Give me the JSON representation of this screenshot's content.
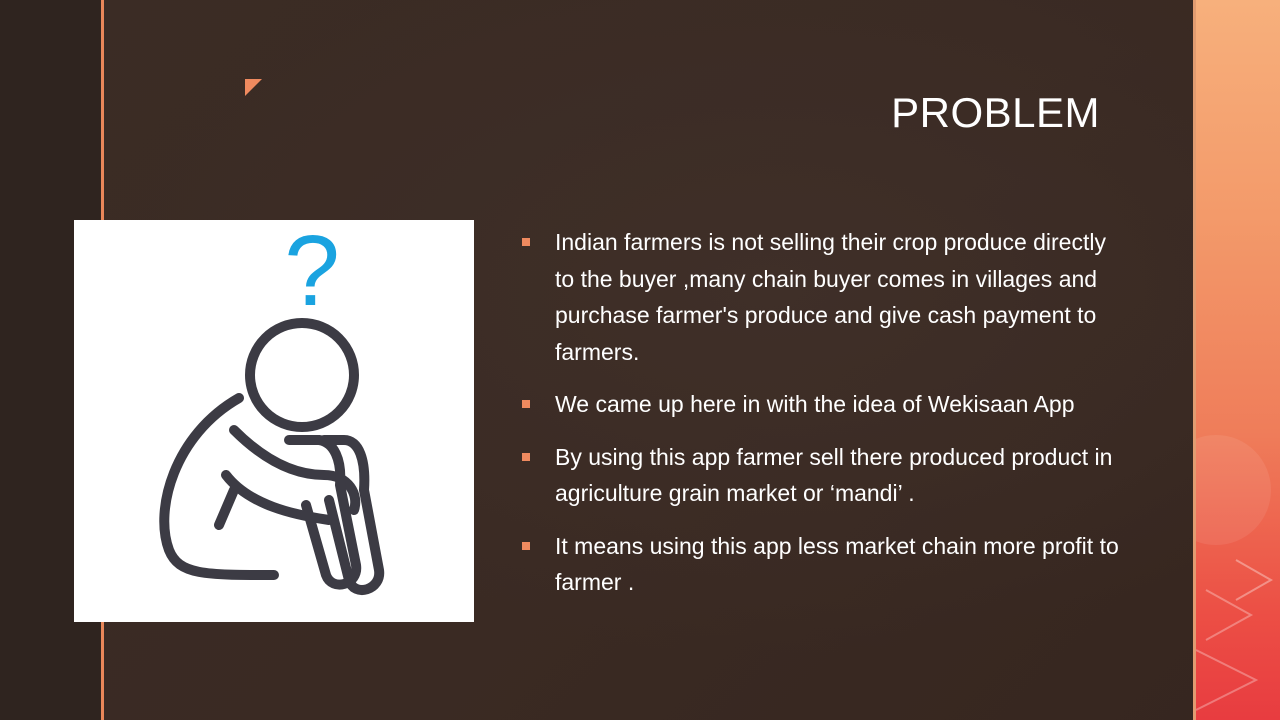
{
  "slide": {
    "title": "PROBLEM",
    "image": {
      "question_mark": "?",
      "icon": "sad-person-hugging-knees-icon"
    },
    "bullets": [
      "Indian farmers is not selling their crop produce directly to the buyer ,many chain buyer comes in villages and purchase farmer's produce and give cash payment to farmers.",
      "We came up here in with the idea of Wekisaan App",
      "By using this app farmer sell there  produced product in agriculture grain market or ‘mandi’ .",
      "It means using this app less market chain more profit to farmer ."
    ]
  },
  "colors": {
    "background": "#3a2b24",
    "accent": "#ef8a5f",
    "question_mark": "#1aa3e0",
    "figure_stroke": "#3c3b44"
  }
}
